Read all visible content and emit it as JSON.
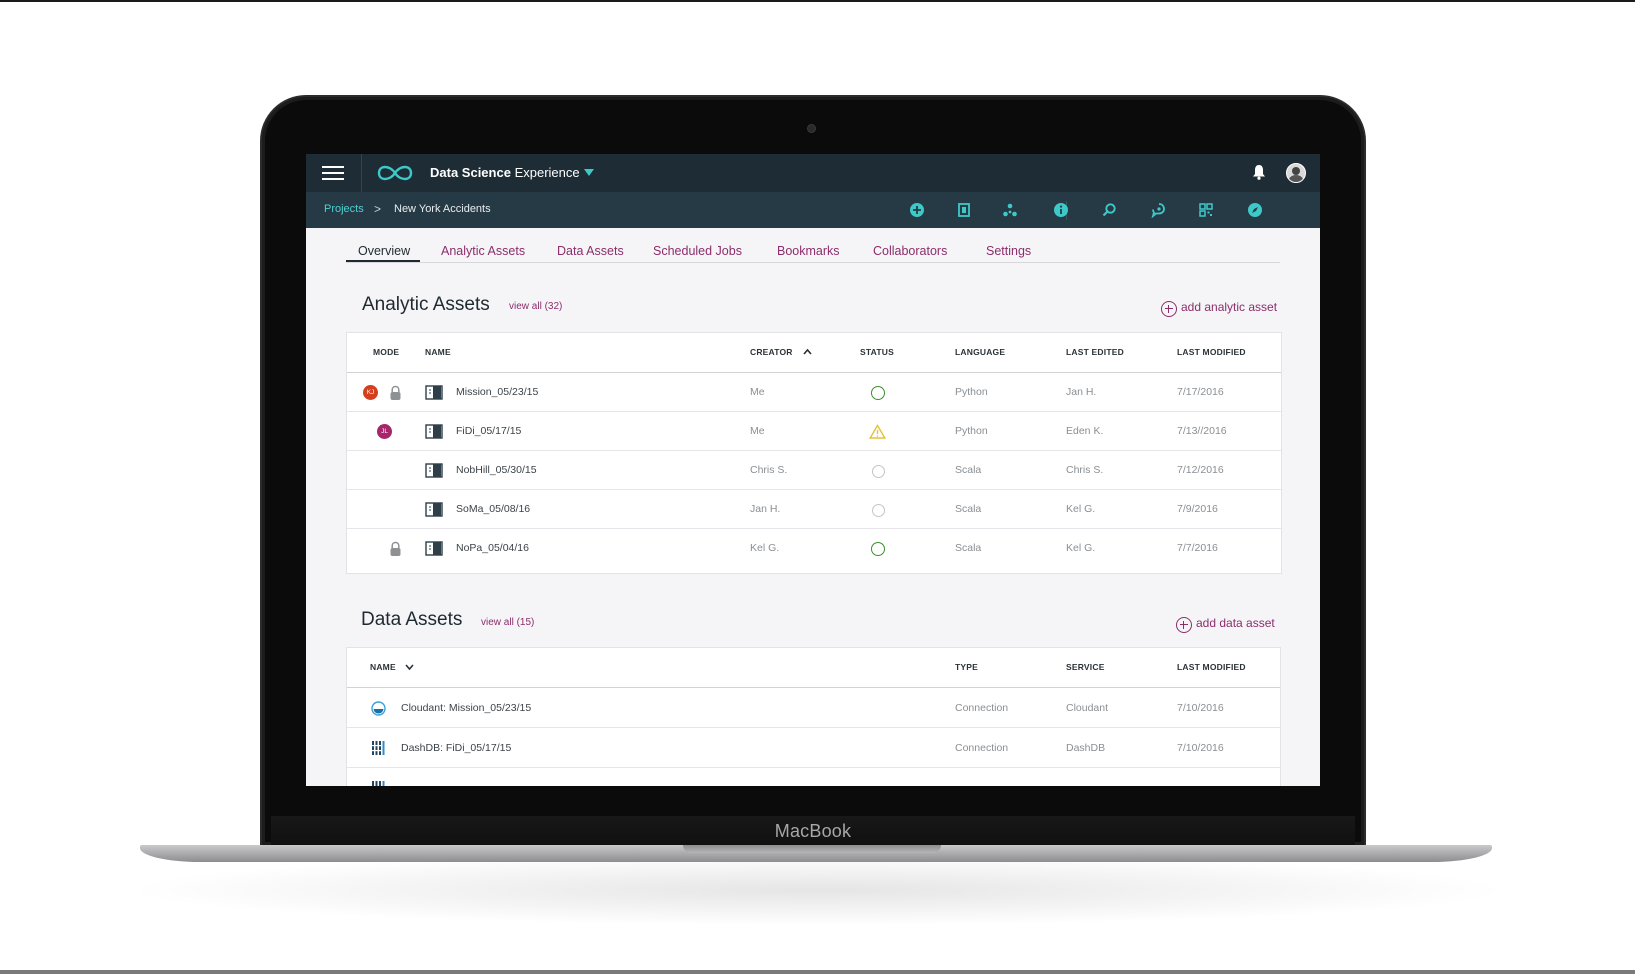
{
  "device": {
    "brand": "MacBook"
  },
  "app": {
    "title_bold": "Data Science",
    "title_rest": "Experience"
  },
  "breadcrumb": {
    "parent": "Projects",
    "separator": ">",
    "current": "New York Accidents"
  },
  "toolbar_icons": [
    "add-icon",
    "notebook-icon",
    "graph-nodes-icon",
    "info-icon",
    "find-icon",
    "chat-icon",
    "grid-icon",
    "compass-icon"
  ],
  "tabs": [
    {
      "label": "Overview",
      "active": true
    },
    {
      "label": "Analytic Assets",
      "active": false
    },
    {
      "label": "Data Assets",
      "active": false
    },
    {
      "label": "Scheduled Jobs",
      "active": false
    },
    {
      "label": "Bookmarks",
      "active": false
    },
    {
      "label": "Collaborators",
      "active": false
    },
    {
      "label": "Settings",
      "active": false
    }
  ],
  "analytic_assets": {
    "title": "Analytic Assets",
    "view_all": "view all (32)",
    "add_label": "add analytic asset",
    "columns": {
      "mode": "MODE",
      "name": "NAME",
      "creator": "CREATOR",
      "status": "STATUS",
      "language": "LANGUAGE",
      "last_edited": "LAST EDITED",
      "last_modified": "LAST MODIFIED"
    },
    "rows": [
      {
        "badge": "KJ",
        "badge_color": "#d2401f",
        "locked": true,
        "name": "Mission_05/23/15",
        "creator": "Me",
        "status": "ok",
        "language": "Python",
        "last_edited": "Jan H.",
        "last_modified": "7/17/2016"
      },
      {
        "badge": "JL",
        "badge_color": "#a8246b",
        "locked": false,
        "name": "FiDi_05/17/15",
        "creator": "Me",
        "status": "warning",
        "language": "Python",
        "last_edited": "Eden K.",
        "last_modified": "7/13//2016"
      },
      {
        "badge": "",
        "badge_color": "",
        "locked": false,
        "name": "NobHill_05/30/15",
        "creator": "Chris S.",
        "status": "idle",
        "language": "Scala",
        "last_edited": "Chris S.",
        "last_modified": "7/12/2016"
      },
      {
        "badge": "",
        "badge_color": "",
        "locked": false,
        "name": "SoMa_05/08/16",
        "creator": "Jan H.",
        "status": "idle",
        "language": "Scala",
        "last_edited": "Kel G.",
        "last_modified": "7/9/2016"
      },
      {
        "badge": "",
        "badge_color": "",
        "locked": true,
        "name": "NoPa_05/04/16",
        "creator": "Kel G.",
        "status": "ok",
        "language": "Scala",
        "last_edited": "Kel G.",
        "last_modified": "7/7/2016"
      }
    ]
  },
  "data_assets": {
    "title": "Data Assets",
    "view_all": "view all (15)",
    "add_label": "add data asset",
    "columns": {
      "name": "NAME",
      "type": "TYPE",
      "service": "SERVICE",
      "last_modified": "LAST MODIFIED"
    },
    "rows": [
      {
        "icon": "cloudant-icon",
        "name": "Cloudant: Mission_05/23/15",
        "type": "Connection",
        "service": "Cloudant",
        "last_modified": "7/10/2016"
      },
      {
        "icon": "dashdb-icon",
        "name": "DashDB: FiDi_05/17/15",
        "type": "Connection",
        "service": "DashDB",
        "last_modified": "7/10/2016"
      }
    ]
  },
  "colors": {
    "topbar": "#1d2c35",
    "crumbbar": "#263a45",
    "accent_teal": "#3ec9c9",
    "link_magenta": "#8c2e6b",
    "status_ok": "#3e8e2f",
    "status_warning": "#e3c23a"
  }
}
